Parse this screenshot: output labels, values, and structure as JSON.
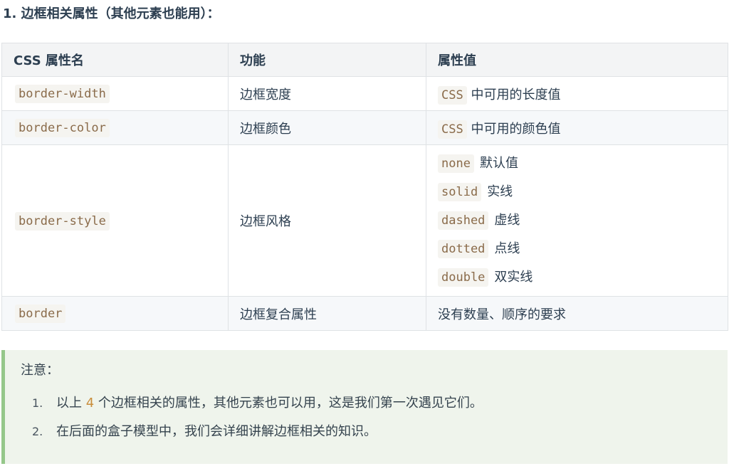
{
  "heading": "1. 边框相关属性（其他元素也能用）：",
  "table": {
    "headers": [
      "CSS 属性名",
      "功能",
      "属性值"
    ],
    "rows": [
      {
        "name": "border-width",
        "function": "边框宽度",
        "value_code": "CSS",
        "value_text": "中可用的长度值"
      },
      {
        "name": "border-color",
        "function": "边框颜色",
        "value_code": "CSS",
        "value_text": "中可用的颜色值"
      },
      {
        "name": "border-style",
        "function": "边框风格",
        "styles": [
          {
            "code": "none",
            "desc": "默认值"
          },
          {
            "code": "solid",
            "desc": "实线"
          },
          {
            "code": "dashed",
            "desc": "虚线"
          },
          {
            "code": "dotted",
            "desc": "点线"
          },
          {
            "code": "double",
            "desc": "双实线"
          }
        ]
      },
      {
        "name": "border",
        "function": "边框复合属性",
        "value_text": "没有数量、顺序的要求"
      }
    ]
  },
  "tip": {
    "title": "注意：",
    "items": [
      {
        "num": "1.",
        "before": "以上",
        "highlight": "4",
        "after": "个边框相关的属性，其他元素也可以用，这是我们第一次遇见它们。"
      },
      {
        "num": "2.",
        "text": "在后面的盒子模型中，我们会详细讲解边框相关的知识。"
      }
    ]
  },
  "colors": {
    "code_text": "#8a6b4a",
    "tip_background": "#eff4ec",
    "tip_border": "#95c78a",
    "highlight": "#c98d3b"
  }
}
